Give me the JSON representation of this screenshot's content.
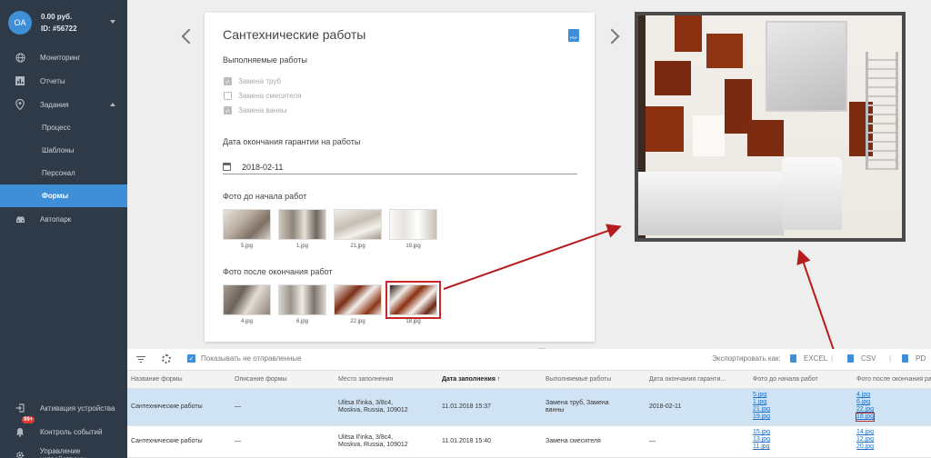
{
  "account": {
    "initials": "OA",
    "balance": "0.00 руб.",
    "id": "ID: #56722"
  },
  "sidebar": {
    "items": [
      {
        "label": "Мониторинг",
        "icon": "globe-icon"
      },
      {
        "label": "Отчеты",
        "icon": "chart-icon"
      },
      {
        "label": "Задания",
        "icon": "location-pin-icon"
      }
    ],
    "sub_items": [
      {
        "label": "Процесс"
      },
      {
        "label": "Шаблоны"
      },
      {
        "label": "Персонал"
      },
      {
        "label": "Формы"
      }
    ],
    "autopark": {
      "label": "Автопарк",
      "icon": "car-icon"
    },
    "bottom": [
      {
        "label": "Активация устройства",
        "icon": "login-icon"
      },
      {
        "label": "Контроль событий",
        "icon": "bell-icon",
        "badge": "99+"
      },
      {
        "label": "Управление устройствами",
        "icon": "gear-icon"
      }
    ]
  },
  "form": {
    "title": "Сантехнические работы",
    "pdf_label": "PDF",
    "works_label": "Выполняемые работы",
    "works": [
      {
        "label": "Замена труб",
        "checked": true
      },
      {
        "label": "Замена смесителя",
        "checked": false
      },
      {
        "label": "Замена ванны",
        "checked": true
      }
    ],
    "warranty_label": "Дата окончания гарантии на работы",
    "warranty_date": "2018-02-11",
    "photos_before_label": "Фото до начала работ",
    "photos_before": [
      "5.jpg",
      "1.jpg",
      "21.jpg",
      "19.jpg"
    ],
    "photos_after_label": "Фото после окончания работ",
    "photos_after": [
      "4.jpg",
      "6.jpg",
      "22.jpg",
      "18.jpg"
    ],
    "selected_photo": "18.jpg"
  },
  "toolbar": {
    "show_unsent_label": "Показывать не отправленные",
    "export_label": "Экспортировать как:",
    "excel_label": "EXCEL",
    "csv_label": "CSV",
    "pdf_label": "PD"
  },
  "table": {
    "columns": [
      "Название формы",
      "Описание формы",
      "Место заполнения",
      "Дата заполнения",
      "Выполняемые работы",
      "Дата окончания гаранти...",
      "Фото до начала работ",
      "Фото после окончания ра..."
    ],
    "sorted_column_arrow": "↑",
    "rows": [
      {
        "name": "Сантехнические работы",
        "desc": "—",
        "place": [
          "Ulitsa Il'inka, 3/8c4,",
          "Moskva, Russia, 109012"
        ],
        "date": "11.01.2018 15:37",
        "works": [
          "Замена труб, Замена",
          "ванны"
        ],
        "warranty": "2018-02-11",
        "before": [
          "5.jpg",
          "1.jpg",
          "21.jpg",
          "19.jpg"
        ],
        "after": [
          "4.jpg",
          "6.jpg",
          "22.jpg",
          "18.jpg"
        ]
      },
      {
        "name": "Сантехнические работы",
        "desc": "—",
        "place": [
          "Ulitsa Il'inka, 3/8c4,",
          "Moskva, Russia, 109012"
        ],
        "date": "11.01.2018 15:40",
        "works": [
          "Замена смесителя"
        ],
        "warranty": "—",
        "before": [
          "15.jpg",
          "13.jpg",
          "11.jpg"
        ],
        "after": [
          "14.jpg",
          "12.jpg",
          "20.jpg"
        ]
      }
    ]
  },
  "colors": {
    "accent": "#3f8fd8",
    "sidebar": "#2f3a48",
    "highlight": "#c62828",
    "row_selected": "#cfe3f4"
  }
}
